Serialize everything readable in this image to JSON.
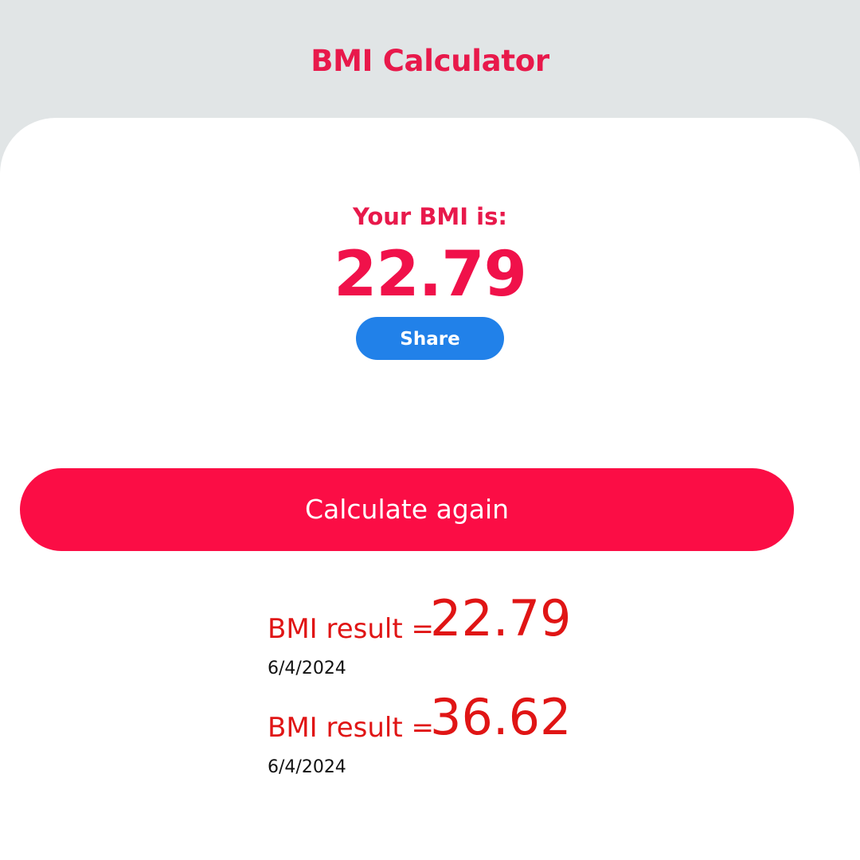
{
  "header": {
    "title": "BMI Calculator"
  },
  "result": {
    "label": "Your BMI is:",
    "value": "22.79",
    "share_label": "Share"
  },
  "actions": {
    "calculate_again_label": "Calculate again"
  },
  "history": [
    {
      "prefix": "BMI result =",
      "value": "22.79",
      "date": "6/4/2024"
    },
    {
      "prefix": "BMI result =",
      "value": "36.62",
      "date": "6/4/2024"
    }
  ],
  "colors": {
    "accent": "#e8194b",
    "primary_button": "#fb0d45",
    "share_button": "#2181e9",
    "history_text": "#e01515",
    "header_background": "#e1e5e6"
  }
}
